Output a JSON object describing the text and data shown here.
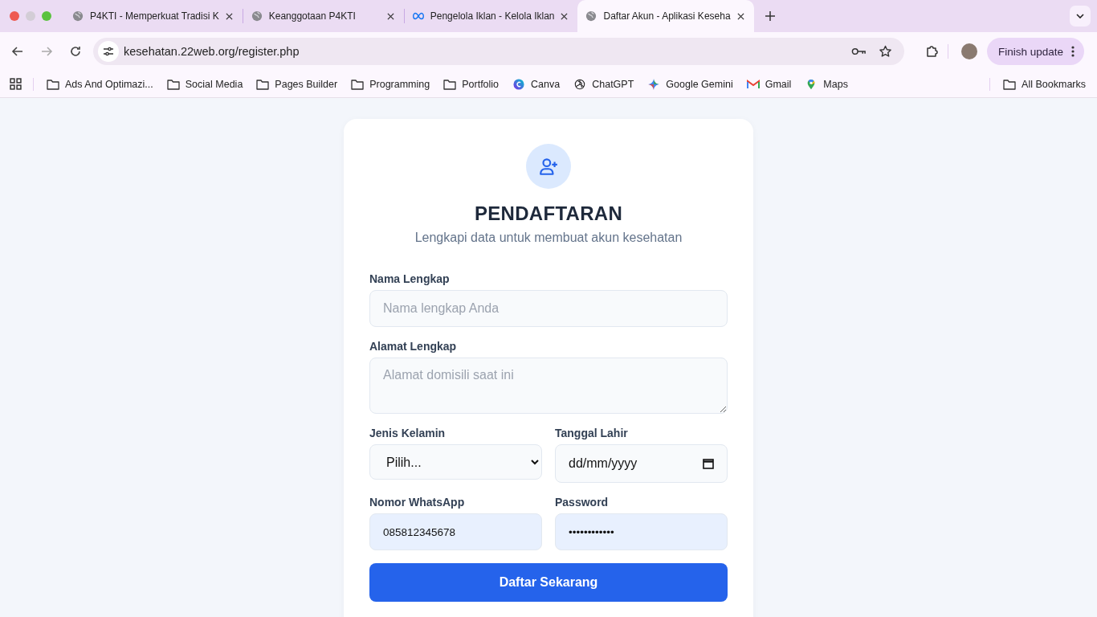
{
  "tabs": [
    {
      "title": "P4KTI - Memperkuat Tradisi K",
      "kind": "globe",
      "selected": false
    },
    {
      "title": "Keanggotaan P4KTI",
      "kind": "globe",
      "selected": false
    },
    {
      "title": "Pengelola Iklan - Kelola Iklan",
      "kind": "meta",
      "selected": false
    },
    {
      "title": "Daftar Akun - Aplikasi Keseha",
      "kind": "globe",
      "selected": true
    }
  ],
  "address_bar": {
    "url": "kesehatan.22web.org/register.php"
  },
  "update_button": "Finish update",
  "bookmarks": [
    {
      "label": "Ads And Optimazi...",
      "kind": "folder"
    },
    {
      "label": "Social Media",
      "kind": "folder"
    },
    {
      "label": "Pages Builder",
      "kind": "folder"
    },
    {
      "label": "Programming",
      "kind": "folder"
    },
    {
      "label": "Portfolio",
      "kind": "folder"
    },
    {
      "label": "Canva",
      "kind": "canva"
    },
    {
      "label": "ChatGPT",
      "kind": "chatgpt"
    },
    {
      "label": "Google Gemini",
      "kind": "gemini"
    },
    {
      "label": "Gmail",
      "kind": "gmail"
    },
    {
      "label": "Maps",
      "kind": "maps"
    }
  ],
  "all_bookmarks": "All Bookmarks",
  "form": {
    "title": "PENDAFTARAN",
    "subtitle": "Lengkapi data untuk membuat akun kesehatan",
    "rows": [
      [
        {
          "label": "Nama Lengkap",
          "kind": "text",
          "placeholder": "Nama lengkap Anda"
        }
      ],
      [
        {
          "label": "Alamat Lengkap",
          "kind": "textarea",
          "placeholder": "Alamat domisili saat ini"
        }
      ],
      [
        {
          "label": "Jenis Kelamin",
          "kind": "select",
          "value": "Pilih..."
        },
        {
          "label": "Tanggal Lahir",
          "kind": "date",
          "value": "dd/mm/yyyy"
        }
      ],
      [
        {
          "label": "Nomor WhatsApp",
          "kind": "filled",
          "value": "085812345678"
        },
        {
          "label": "Password",
          "kind": "filled",
          "value": "••••••••••••"
        }
      ]
    ],
    "submit": "Daftar Sekarang"
  }
}
